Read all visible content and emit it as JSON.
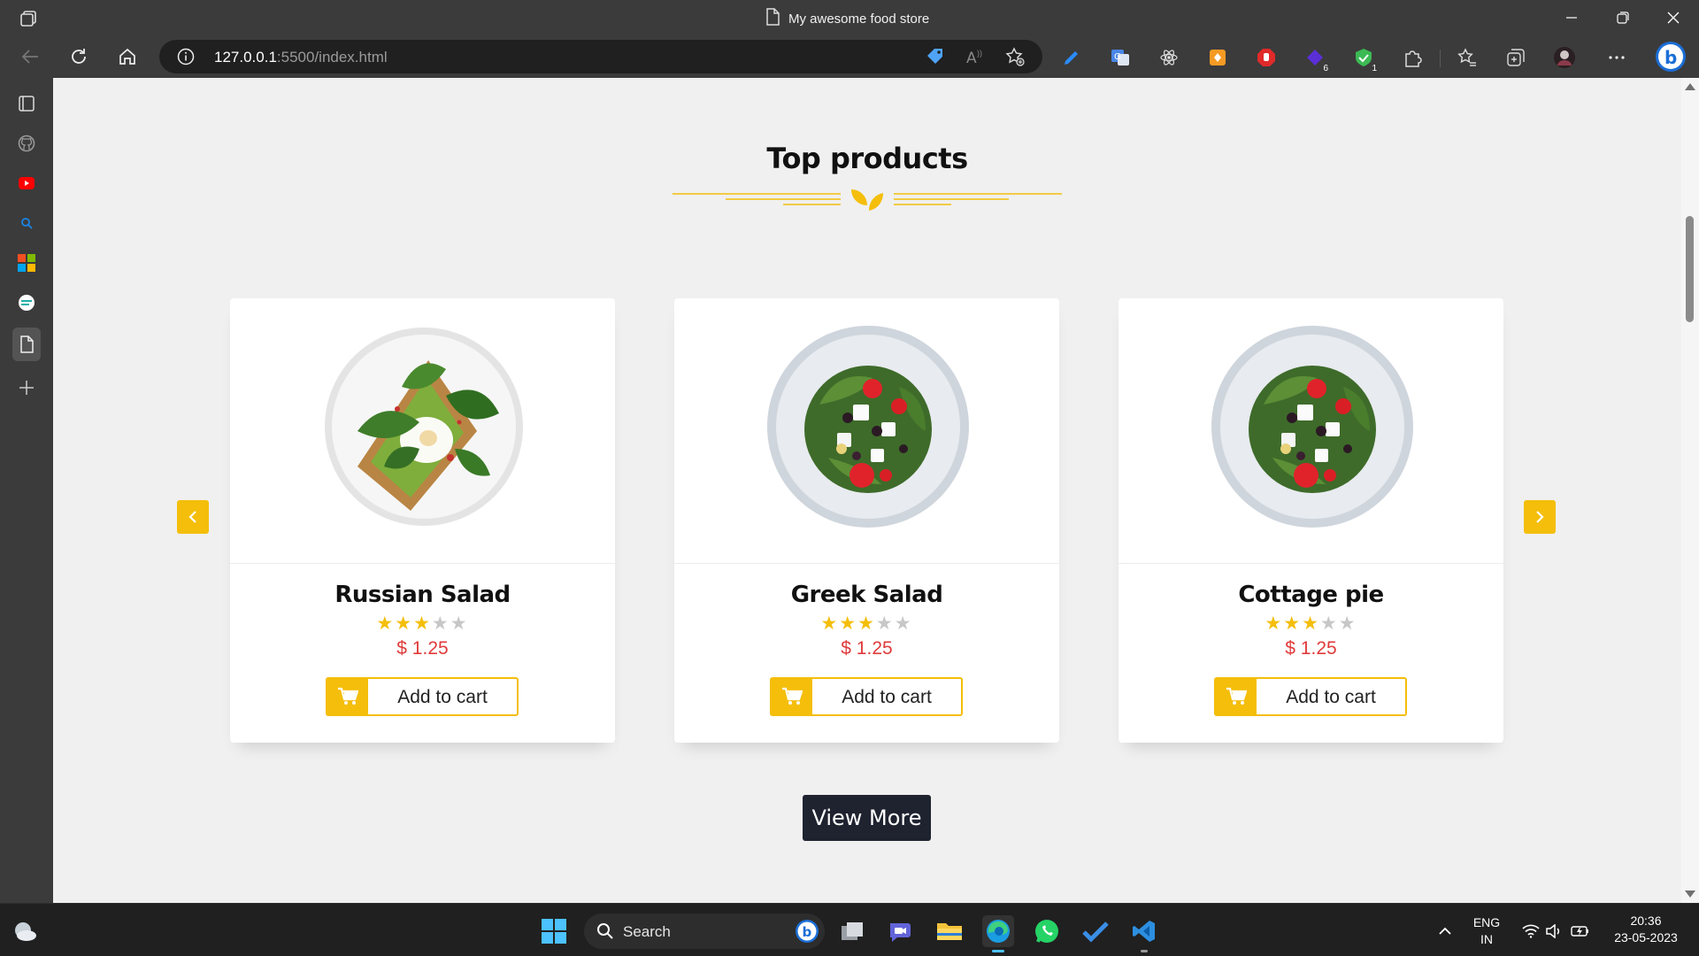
{
  "window": {
    "tab_title": "My awesome food store"
  },
  "toolbar": {
    "url_host": "127.0.0.1",
    "url_rest": ":5500/index.html",
    "extension_badges": [
      "6",
      "1"
    ]
  },
  "page": {
    "section_title": "Top products",
    "products": [
      {
        "name": "Russian Salad",
        "rating": 3,
        "max_rating": 5,
        "price": "$ 1.25",
        "cart_label": "Add to cart",
        "image": "spinach-toast-plate"
      },
      {
        "name": "Greek Salad",
        "rating": 3,
        "max_rating": 5,
        "price": "$ 1.25",
        "cart_label": "Add to cart",
        "image": "greek-salad-plate"
      },
      {
        "name": "Cottage pie",
        "rating": 3,
        "max_rating": 5,
        "price": "$ 1.25",
        "cart_label": "Add to cart",
        "image": "greek-salad-plate"
      }
    ],
    "view_more_label": "View More",
    "accent_color": "#f4be0b",
    "price_color": "#e03b3b"
  },
  "taskbar": {
    "search_label": "Search",
    "language_line1": "ENG",
    "language_line2": "IN",
    "time": "20:36",
    "date": "23-05-2023"
  }
}
